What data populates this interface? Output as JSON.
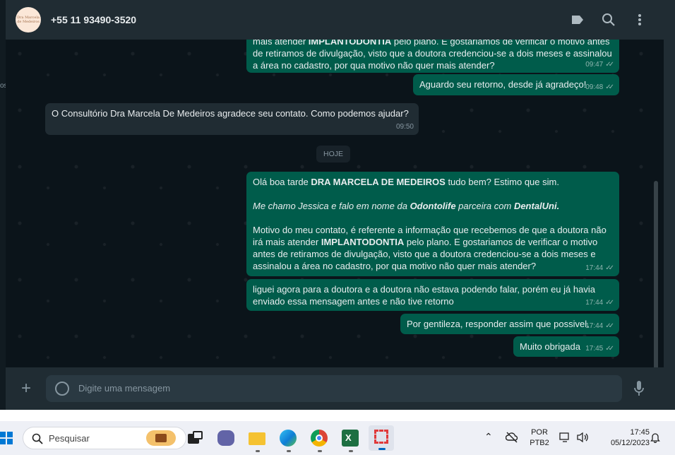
{
  "header": {
    "avatar_text": "Dra Marcela de Medeiros",
    "contact_name": "+55 11 93490-3520"
  },
  "left_fragment": "os",
  "messages": [
    {
      "dir": "out",
      "lines_html": "mais atender <b>IMPLANTODONTIA</b> pelo plano. E gostariamos de verificar o motivo antes de retiramos de divulgação, visto que a doutora credenciou-se a dois meses e assinalou a área no cadastro, por qua motivo não quer mais  atender?",
      "time": "09:47"
    },
    {
      "dir": "out",
      "text": "Aguardo seu retorno, desde já agradeço!",
      "time": "09:48"
    },
    {
      "dir": "in",
      "text": "O Consultório Dra Marcela De Medeiros agradece seu contato. Como podemos ajudar?",
      "time": "09:50"
    },
    {
      "dir": "out",
      "time": "17:44",
      "p1_pre": "Olá boa tarde ",
      "p1_bold": "DRA MARCELA DE MEDEIROS",
      "p1_post": " tudo bem? Estimo que sim.",
      "p2_pre": "Me chamo Jessica e falo em nome da ",
      "p2_bold1": "Odontolife",
      "p2_mid": " parceira com ",
      "p2_bold2": "DentalUni.",
      "p3_pre": "Motivo do meu contato, é referente a informação que recebemos de que a doutora não irá mais atender ",
      "p3_bold": "IMPLANTODONTIA",
      "p3_post": " pelo plano. E gostariamos de verificar o motivo antes de retiramos de divulgação, visto que a doutora credenciou-se a dois meses e assinalou a área no cadastro, por qua motivo não quer mais  atender?"
    },
    {
      "dir": "out",
      "text": "liguei agora para a doutora e a doutora não estava podendo falar, porém eu já havia enviado essa mensagem antes e não tive retorno",
      "time": "17:44"
    },
    {
      "dir": "out",
      "text": "Por gentileza, responder assim que possivel.",
      "time": "17:44"
    },
    {
      "dir": "out",
      "text": "Muito obrigada",
      "time": "17:45"
    }
  ],
  "date_divider": "HOJE",
  "composer": {
    "placeholder": "Digite uma mensagem"
  },
  "taskbar": {
    "search_placeholder": "Pesquisar",
    "language_line1": "POR",
    "language_line2": "PTB2",
    "time": "17:45",
    "date": "05/12/2023"
  },
  "colors": {
    "outgoing_bubble": "#005c4b",
    "incoming_bubble": "#202c33",
    "chat_background": "#0b141a",
    "header_background": "#202c33"
  }
}
